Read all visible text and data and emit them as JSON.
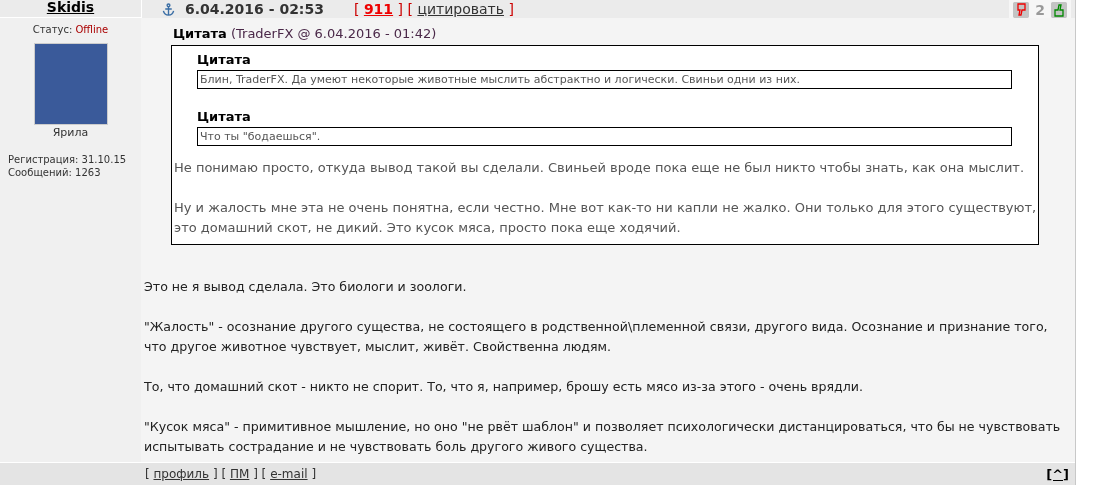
{
  "header": {
    "author": "Skidis",
    "date": "6.04.2016 - 02:53",
    "links": [
      {
        "kind": "text",
        "text": "[ "
      },
      {
        "kind": "number",
        "text": "911"
      },
      {
        "kind": "text",
        "text": " ] [ "
      },
      {
        "kind": "link",
        "text": "цитировать"
      },
      {
        "kind": "text",
        "text": " ]"
      }
    ],
    "rating": "2"
  },
  "user": {
    "status_label": "Статус:",
    "status": "Offline",
    "rank": "Ярила",
    "registration": "Регистрация: 31.10.15",
    "messages": "Сообщений: 1263"
  },
  "quote": {
    "label": "Цитата",
    "source": "(TraderFX @ 6.04.2016 - 01:42)",
    "inner_quotes": [
      {
        "label": "Цитата",
        "text": "Блин, TraderFX. Да умеют некоторые животные мыслить абстрактно и логически. Свиньи одни из них."
      },
      {
        "label": "Цитата",
        "text": "Что ты \"бодаешься\"."
      }
    ],
    "paragraphs": [
      "Не понимаю просто, откуда вывод такой вы сделали. Свиньей вроде пока еще не был никто чтобы знать, как она мыслит.",
      "Ну и жалость мне эта не очень понятна, если честно. Мне вот как-то ни капли не жалко. Они только для этого существуют, это домашний скот, не дикий. Это кусок мяса, просто пока еще ходячий."
    ]
  },
  "paragraphs": [
    "Это не я вывод сделала. Это биологи и зоологи.",
    "\"Жалость\" - осознание другого существа, не состоящего в родственной\\племенной связи, другого вида. Осознание и признание того, что другое животное чувствует, мыслит, живёт. Свойственна людям.",
    "То, что домашний скот - никто не спорит. То, что я, например, брошу есть мясо из-за этого - очень врядли.",
    "\"Кусок мяса\" - примитивное мышление, но оно \"не рвёт шаблон\" и позволяет психологически дистанцироваться, что бы не чувствовать испытывать сострадание и не чувствовать боль другого живого существа."
  ],
  "footer": {
    "links": [
      {
        "kind": "text",
        "text": "[ "
      },
      {
        "kind": "link",
        "text": "профиль"
      },
      {
        "kind": "text",
        "text": " ] [ "
      },
      {
        "kind": "link",
        "text": "ПМ"
      },
      {
        "kind": "text",
        "text": " ] [ "
      },
      {
        "kind": "link",
        "text": "e-mail"
      },
      {
        "kind": "text",
        "text": " ]"
      }
    ],
    "top_link": "[^]"
  }
}
